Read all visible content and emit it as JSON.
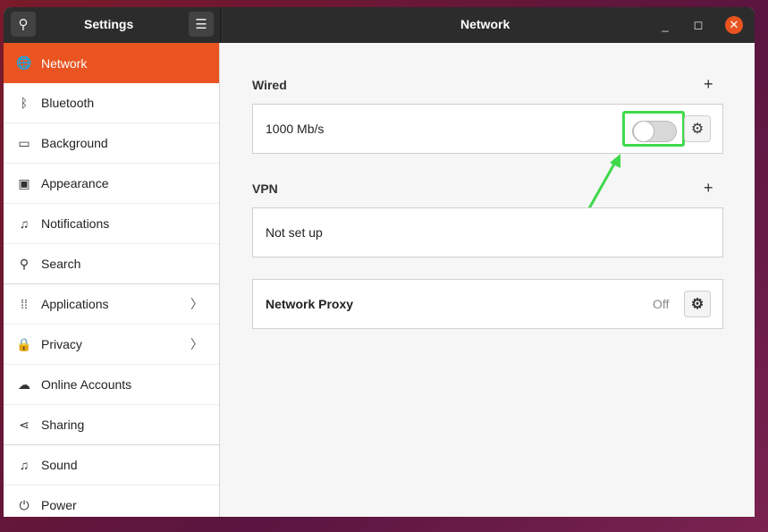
{
  "header": {
    "sidebar_title": "Settings",
    "main_title": "Network"
  },
  "sidebar": {
    "items": [
      {
        "label": "Network",
        "icon": "network-icon",
        "glyph": "🌐"
      },
      {
        "label": "Bluetooth",
        "icon": "bluetooth-icon",
        "glyph": "ᛒ"
      },
      {
        "label": "Background",
        "icon": "background-icon",
        "glyph": "▭"
      },
      {
        "label": "Appearance",
        "icon": "appearance-icon",
        "glyph": "▣"
      },
      {
        "label": "Notifications",
        "icon": "bell-icon",
        "glyph": "♫"
      },
      {
        "label": "Search",
        "icon": "search-icon",
        "glyph": "⚲"
      },
      {
        "label": "Applications",
        "icon": "apps-grid-icon",
        "glyph": "⁞⁞"
      },
      {
        "label": "Privacy",
        "icon": "lock-icon",
        "glyph": "🔒"
      },
      {
        "label": "Online Accounts",
        "icon": "cloud-icon",
        "glyph": "☁"
      },
      {
        "label": "Sharing",
        "icon": "share-icon",
        "glyph": "⋖"
      },
      {
        "label": "Sound",
        "icon": "music-icon",
        "glyph": "♫"
      },
      {
        "label": "Power",
        "icon": "power-icon",
        "glyph": "⏻"
      }
    ]
  },
  "wired": {
    "heading": "Wired",
    "connection": "1000 Mb/s",
    "enabled": false
  },
  "vpn": {
    "heading": "VPN",
    "status": "Not set up"
  },
  "proxy": {
    "label": "Network Proxy",
    "status": "Off"
  },
  "colors": {
    "accent": "#e95420",
    "highlight": "#3fd94a"
  }
}
